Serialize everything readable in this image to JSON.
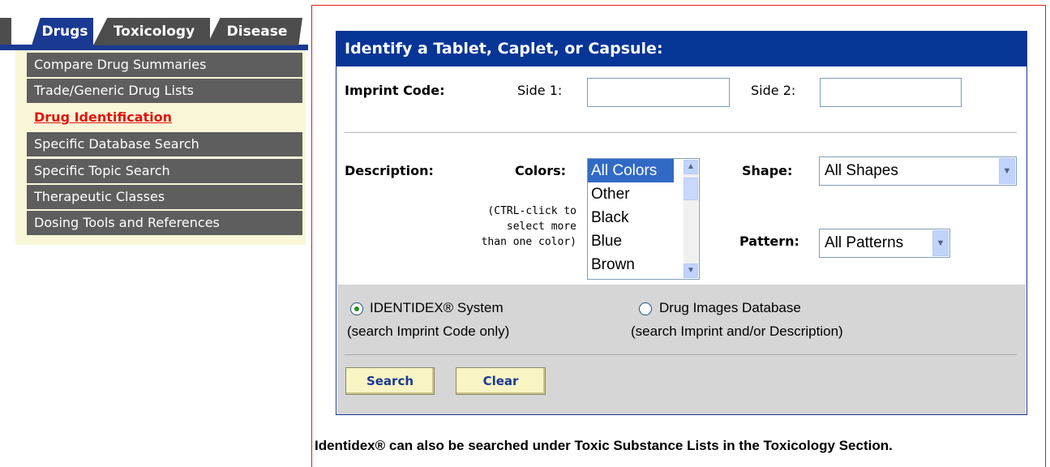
{
  "nav": {
    "tabs": [
      "Drugs",
      "Toxicology",
      "Disease"
    ],
    "menu_items": [
      "Compare Drug Summaries",
      "Trade/Generic Drug Lists",
      "Drug Identification",
      "Specific Database Search",
      "Specific Topic Search",
      "Therapeutic Classes",
      "Dosing Tools and References"
    ]
  },
  "panel": {
    "title": "Identify a Tablet, Caplet, or Capsule:",
    "imprint_label": "Imprint Code:",
    "side1_label": "Side 1:",
    "side2_label": "Side 2:",
    "side1_value": "",
    "side2_value": "",
    "description_label": "Description:",
    "colors_label": "Colors:",
    "colors_note": [
      "(CTRL-click to",
      "select more",
      "than one color)"
    ],
    "color_options": [
      "All Colors",
      "Other",
      "Black",
      "Blue",
      "Brown"
    ],
    "color_selected": "All Colors",
    "shape_label": "Shape:",
    "shape_value": "All Shapes",
    "pattern_label": "Pattern:",
    "pattern_value": "All Patterns"
  },
  "search_options": {
    "identidex": {
      "label": "IDENTIDEX® System",
      "sub": "(search Imprint Code only)",
      "checked": true
    },
    "images": {
      "label": "Drug Images Database",
      "sub": "(search Imprint and/or Description)",
      "checked": false
    }
  },
  "buttons": {
    "search": "Search",
    "clear": "Clear"
  },
  "footer": "Identidex® can also be searched under Toxic Substance Lists in the Toxicology Section."
}
